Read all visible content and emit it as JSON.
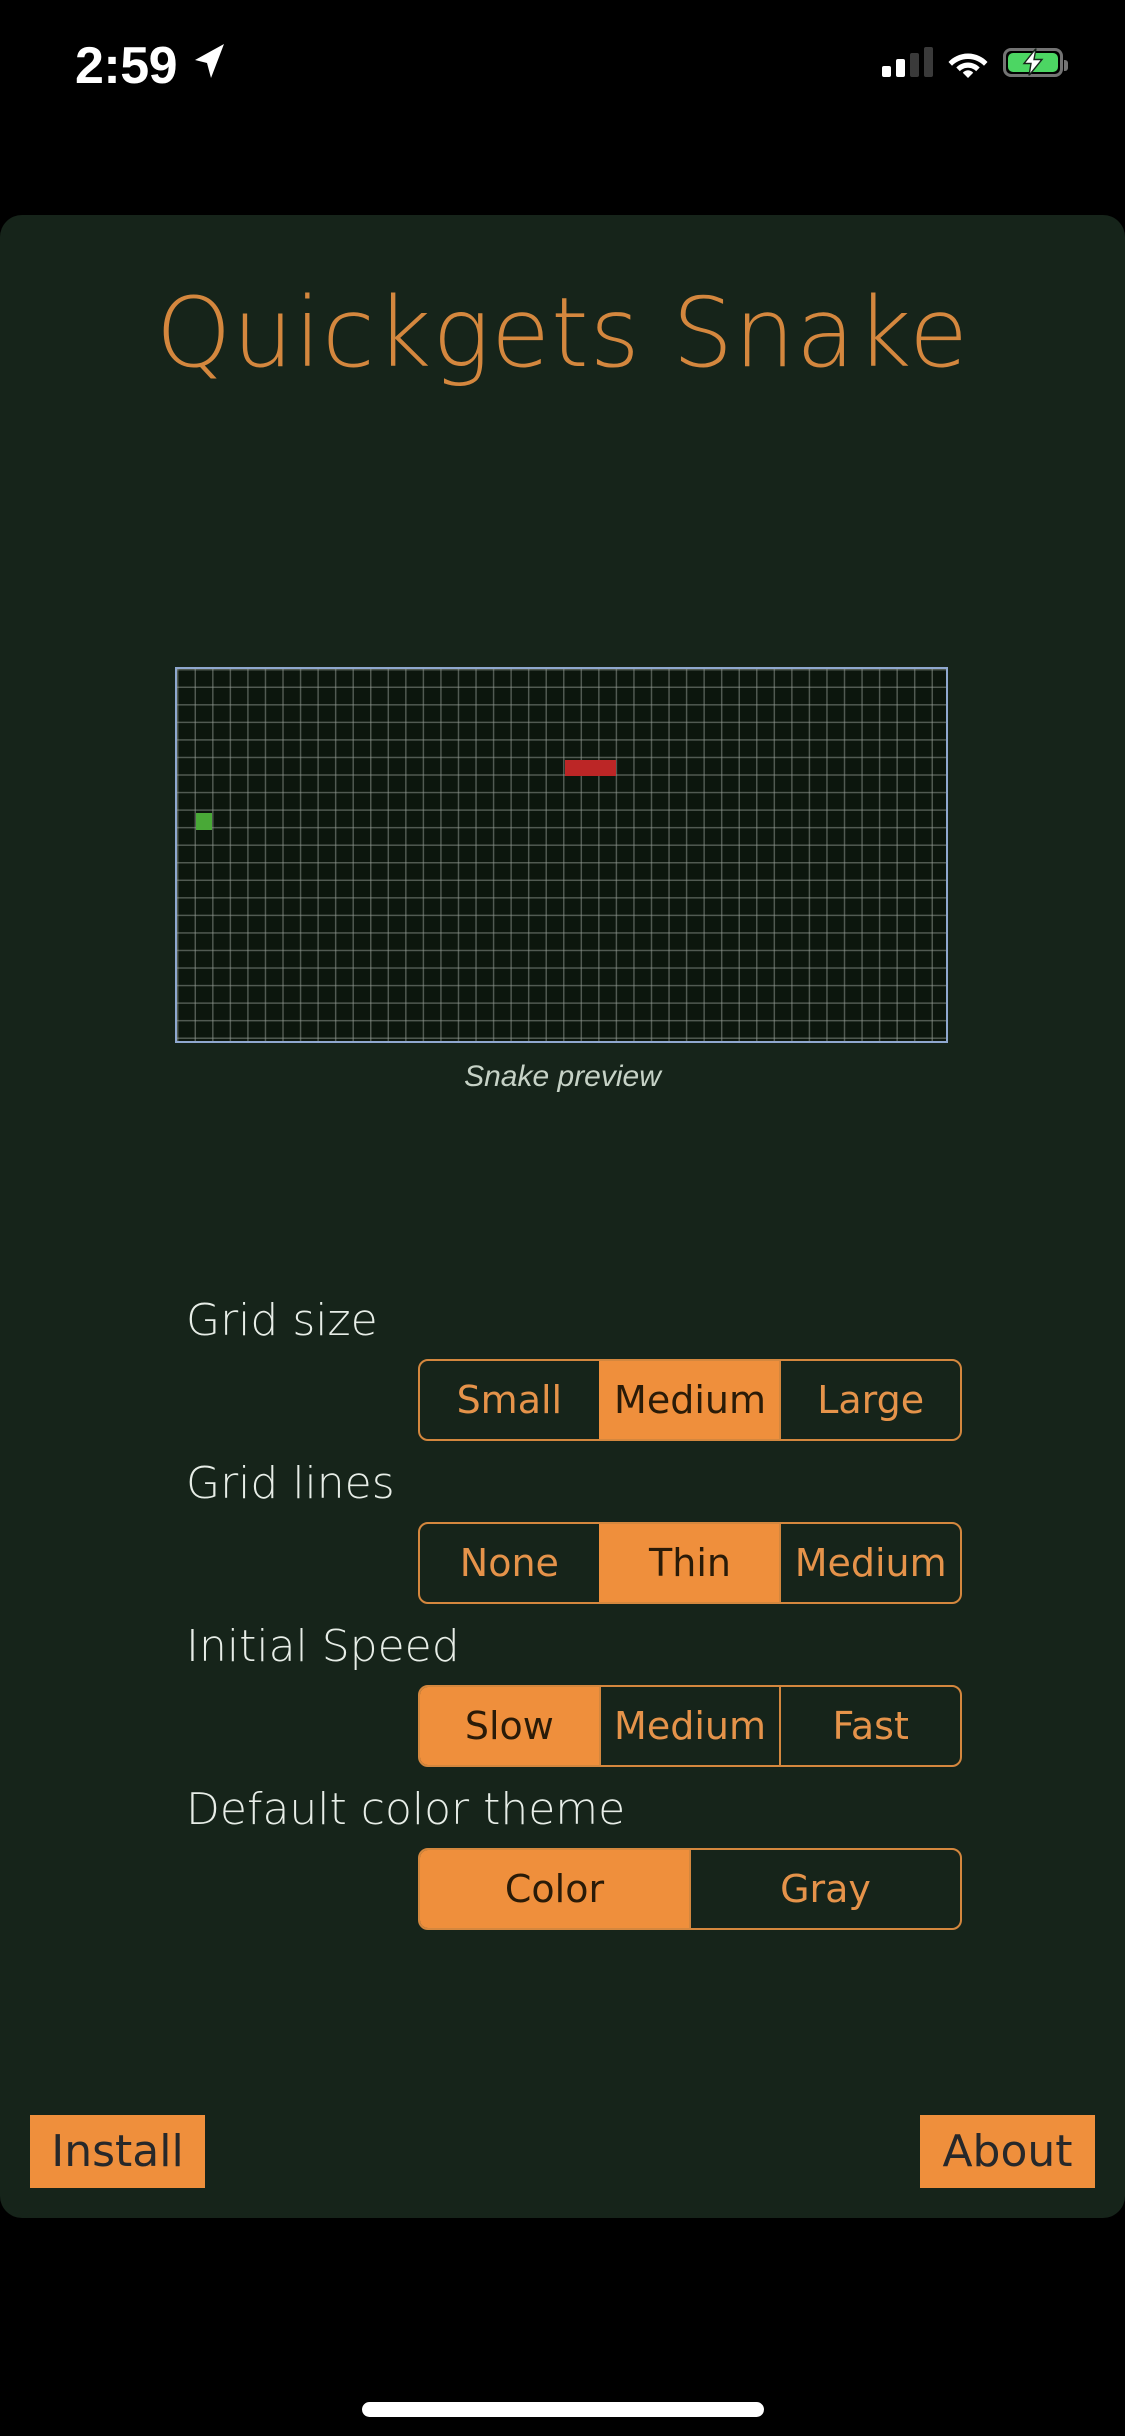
{
  "status_bar": {
    "time": "2:59",
    "location_icon": "location-arrow-icon",
    "signal_icon": "cellular-signal-icon",
    "signal_bars_filled": 2,
    "signal_bars_total": 4,
    "wifi_icon": "wifi-icon",
    "battery_icon": "battery-charging-icon",
    "battery_color": "#4cd663"
  },
  "app": {
    "title": "Quickgets Snake",
    "title_color": "#d4873e",
    "card_background": "#16241a",
    "accent_color": "#ef8f3c"
  },
  "preview": {
    "caption": "Snake preview",
    "border_color": "#8fa8cf",
    "background": "#0c160d",
    "gridline_color": "#969e96",
    "snake_color": "#bc2626",
    "food_color": "#49a937",
    "cols": 44,
    "rows": 21,
    "snake_cells": [
      [
        22,
        5
      ],
      [
        23,
        5
      ],
      [
        24,
        5
      ]
    ],
    "food_cell": [
      1,
      8
    ]
  },
  "settings": [
    {
      "label": "Grid size",
      "options": [
        "Small",
        "Medium",
        "Large"
      ],
      "selected": "Medium"
    },
    {
      "label": "Grid lines",
      "options": [
        "None",
        "Thin",
        "Medium"
      ],
      "selected": "Thin"
    },
    {
      "label": "Initial Speed",
      "options": [
        "Slow",
        "Medium",
        "Fast"
      ],
      "selected": "Slow"
    },
    {
      "label": "Default color theme",
      "options": [
        "Color",
        "Gray"
      ],
      "selected": "Color"
    }
  ],
  "footer": {
    "install_label": "Install",
    "about_label": "About"
  }
}
